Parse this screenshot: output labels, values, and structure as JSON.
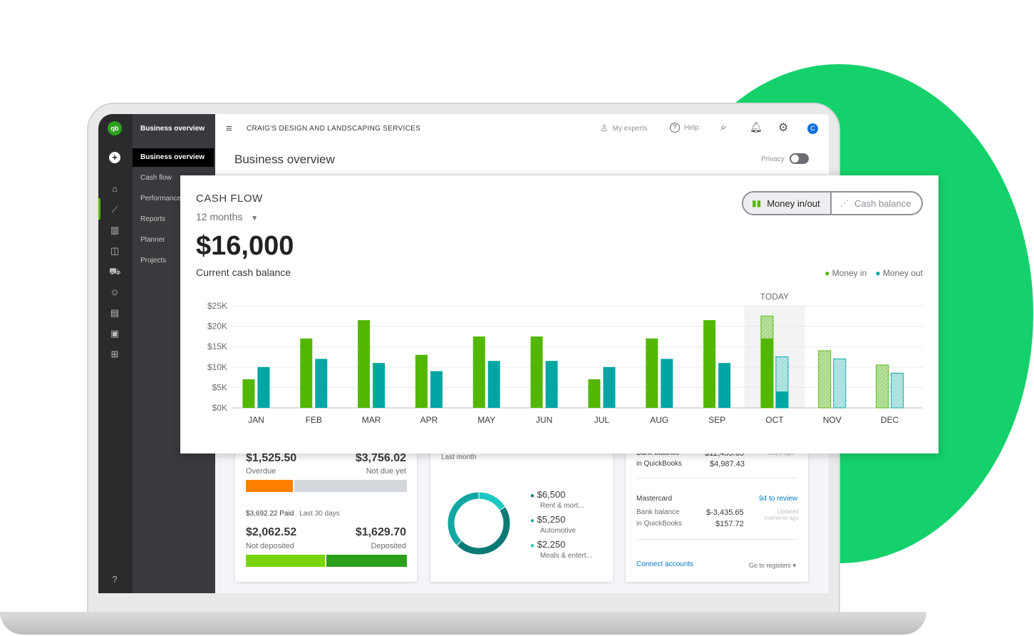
{
  "app": {
    "company": "CRAIG'S DESIGN AND LANDSCAPING SERVICES",
    "page_title": "Business overview",
    "privacy_label": "Privacy",
    "privacy_on": false
  },
  "topbar": {
    "my_experts": "My experts",
    "help": "Help",
    "avatar": "C"
  },
  "sidebar": {
    "header": "Business overview",
    "items": [
      {
        "label": "Business overview"
      },
      {
        "label": "Cash flow"
      },
      {
        "label": "Performance"
      },
      {
        "label": "Reports"
      },
      {
        "label": "Planner"
      },
      {
        "label": "Projects"
      }
    ]
  },
  "cash_flow": {
    "title": "CASH FLOW",
    "period": "12 months",
    "balance": "$16,000",
    "balance_label": "Current cash balance",
    "toggle": [
      "Money in/out",
      "Cash balance"
    ],
    "today_label": "TODAY"
  },
  "chart_data": {
    "type": "bar",
    "categories": [
      "JAN",
      "FEB",
      "MAR",
      "APR",
      "MAY",
      "JUN",
      "JUL",
      "AUG",
      "SEP",
      "OCT",
      "NOV",
      "DEC"
    ],
    "yticks": [
      "$0K",
      "$5K",
      "$10K",
      "$15K",
      "$20K",
      "$25K"
    ],
    "ylim": [
      0,
      25000
    ],
    "grid": true,
    "legend": "top-right",
    "series": [
      {
        "name": "Money in",
        "color": "#53b700",
        "values": [
          7000,
          17000,
          21500,
          13000,
          17500,
          17500,
          7000,
          17000,
          21500,
          17000,
          null,
          null
        ],
        "projected": [
          null,
          null,
          null,
          null,
          null,
          null,
          null,
          null,
          null,
          22500,
          14000,
          10500
        ]
      },
      {
        "name": "Money out",
        "color": "#00a6a4",
        "values": [
          10000,
          12000,
          11000,
          9000,
          11500,
          11500,
          10000,
          12000,
          11000,
          4000,
          null,
          null
        ],
        "projected": [
          null,
          null,
          null,
          null,
          null,
          null,
          null,
          null,
          null,
          12500,
          12000,
          8500
        ]
      }
    ],
    "today_index": 9
  },
  "invoices": {
    "overdue": "$1,525.50",
    "overdue_label": "Overdue",
    "not_due": "$3,756.02",
    "not_due_label": "Not due yet",
    "paid": "$3,692.22 Paid",
    "paid_period": "Last 30 days",
    "not_deposited": "$2,062.52",
    "not_deposited_label": "Not deposited",
    "deposited": "$1,629.70",
    "deposited_label": "Deposited"
  },
  "expenses": {
    "period": "Last month",
    "items": [
      {
        "amount": "$6,500",
        "label": "Rent & mort...",
        "color": "#0b7a75"
      },
      {
        "amount": "$5,250",
        "label": "Automotive",
        "color": "#11a7a2"
      },
      {
        "amount": "$2,250",
        "label": "Meals & entert...",
        "color": "#1bc8c2"
      }
    ]
  },
  "bank": {
    "acct1": {
      "bank_label": "Bank balance",
      "bank": "$12,455.65",
      "qb_label": "in QuickBooks",
      "qb": "$4,987.43",
      "updated": "days ago"
    },
    "acct2": {
      "name": "Mastercard",
      "review": "94 to review",
      "bank_label": "Bank balance",
      "bank": "$-3,435.65",
      "qb_label": "in QuickBooks",
      "qb": "$157.72",
      "updated": "Updated moments ago"
    },
    "connect": "Connect accounts",
    "registers": "Go to registers"
  }
}
